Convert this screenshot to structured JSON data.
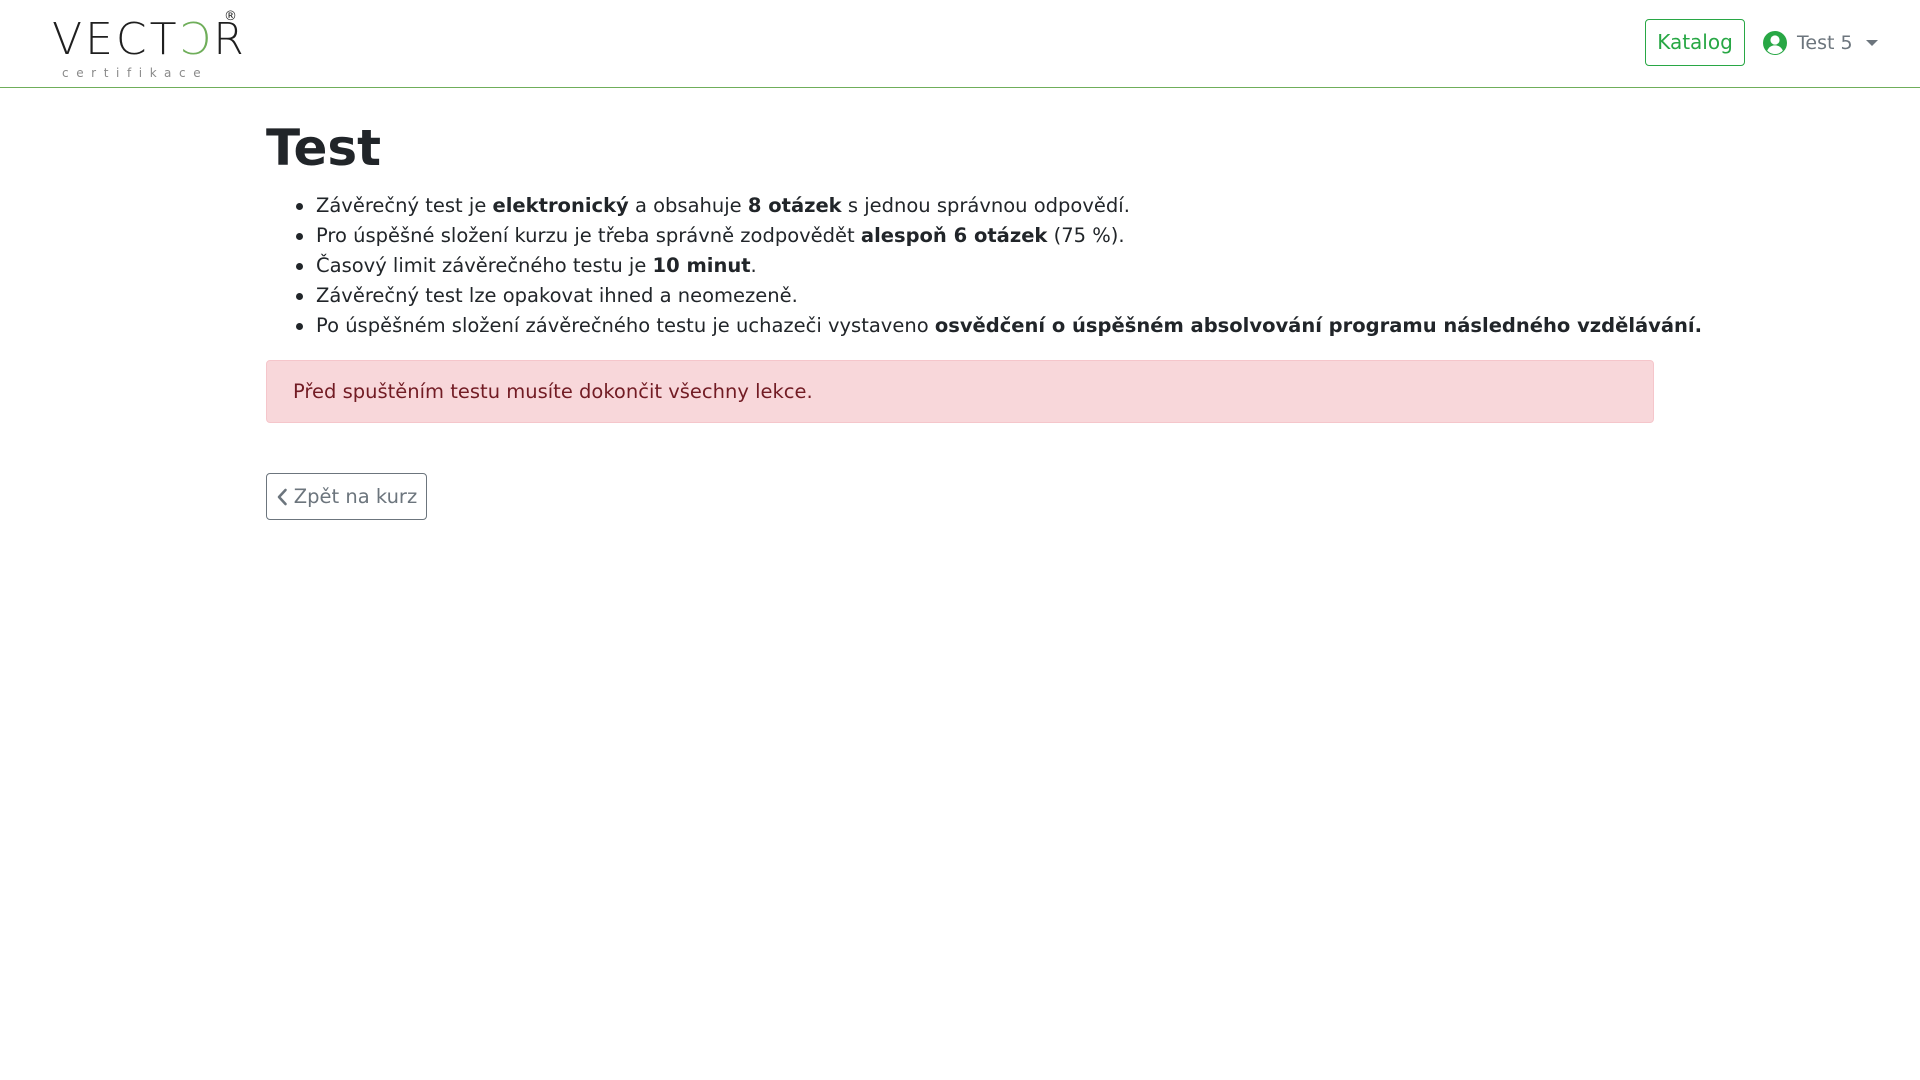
{
  "header": {
    "brand": {
      "word_a": "VEC",
      "word_b": "T",
      "word_c": "Ɔ",
      "word_d": "R",
      "registered": "®",
      "subtitle": "certifikace"
    },
    "catalog_label": "Katalog",
    "user_name": "Test 5",
    "icons": [
      "user-circle-icon",
      "caret-down-icon"
    ],
    "colors": {
      "accent": "#28a745",
      "rule": "#6fae5a"
    }
  },
  "main": {
    "title": "Test",
    "items": [
      {
        "t1": "Závěrečný test je ",
        "b1": "elektronický",
        "t2": " a obsahuje ",
        "b2": "8 otázek",
        "t3": " s jednou správnou odpovědí."
      },
      {
        "t1": "Pro úspěšné složení kurzu je třeba správně zodpovědět ",
        "b1": "alespoň 6 otázek",
        "t2": " (75 %)."
      },
      {
        "t1": "Časový limit závěrečného testu je ",
        "b1": "10 minut",
        "t2": "."
      },
      {
        "t1": "Závěrečný test lze opakovat ihned a neomezeně."
      },
      {
        "t1": "Po úspěšném složení závěrečného testu je uchazeči vystaveno ",
        "b1": "osvědčení o úspěšném absolvování programu následného vzdělávání."
      }
    ],
    "alert_text": "Před spuštěním testu musíte dokončit všechny lekce.",
    "back_label": "Zpět na kurz",
    "back_icon": "chevron-left-icon",
    "colors": {
      "alert_bg": "#f8d7da",
      "alert_text": "#721c24",
      "secondary": "#6c757d"
    }
  }
}
